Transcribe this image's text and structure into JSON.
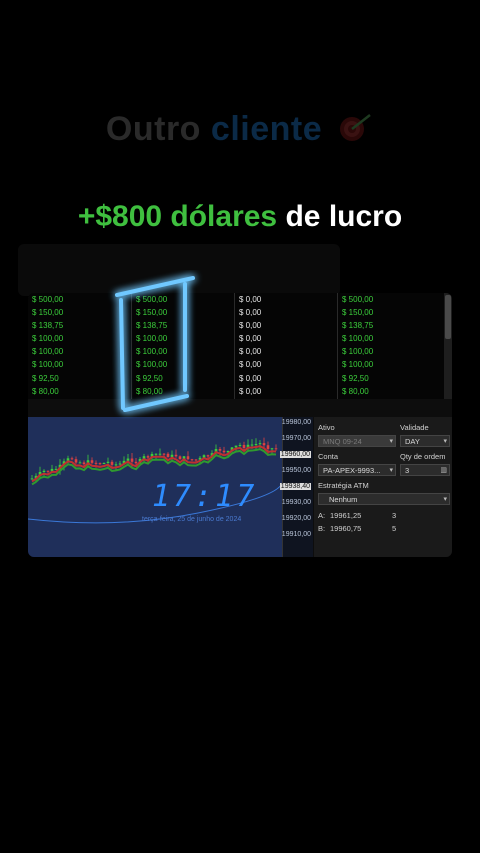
{
  "headline": {
    "word1": "Outro",
    "word2": "cliente",
    "icon": "target-dart-icon"
  },
  "subheadline": {
    "green_part": "+$800 dólares",
    "white_part": "de lucro"
  },
  "pnl_table": {
    "col1": [
      "$ 500,00",
      "$ 150,00",
      "$ 138,75",
      "$ 100,00",
      "$ 100,00",
      "$ 100,00",
      "$ 92,50",
      "$ 80,00"
    ],
    "col2": [
      "$ 500,00",
      "$ 150,00",
      "$ 138,75",
      "$ 100,00",
      "$ 100,00",
      "$ 100,00",
      "$ 92,50",
      "$ 80,00"
    ],
    "col3": [
      "$ 0,00",
      "$ 0,00",
      "$ 0,00",
      "$ 0,00",
      "$ 0,00",
      "$ 0,00",
      "$ 0,00",
      "$ 0,00"
    ],
    "col4": [
      "$ 500,00",
      "$ 150,00",
      "$ 138,75",
      "$ 100,00",
      "$ 100,00",
      "$ 100,00",
      "$ 92,50",
      "$ 80,00"
    ]
  },
  "price_axis": [
    "19980,00",
    "19970,00",
    "19960,00",
    "19950,00",
    "19938,40",
    "19930,00",
    "19920,00",
    "19910,00"
  ],
  "clock": {
    "time": "17:17",
    "date": "terça-feira, 25 de junho de 2024"
  },
  "order_panel": {
    "ativo_label": "Ativo",
    "ativo_value": "MNQ 09-24",
    "validade_label": "Validade",
    "validade_value": "DAY",
    "conta_label": "Conta",
    "conta_value": "PA-APEX-9993...",
    "qty_label": "Qty de ordem",
    "qty_value": "3",
    "estrategia_label": "Estratégia ATM",
    "estrategia_value": "Nenhum",
    "ask_label": "A:",
    "ask_price": "19961,25",
    "ask_qty": "3",
    "bid_label": "B:",
    "bid_price": "19960,75",
    "bid_qty": "5"
  },
  "colors": {
    "profit_green": "#3ccf3c",
    "neon_blue": "#2e8cff",
    "chart_bg": "#1f2f5a"
  }
}
